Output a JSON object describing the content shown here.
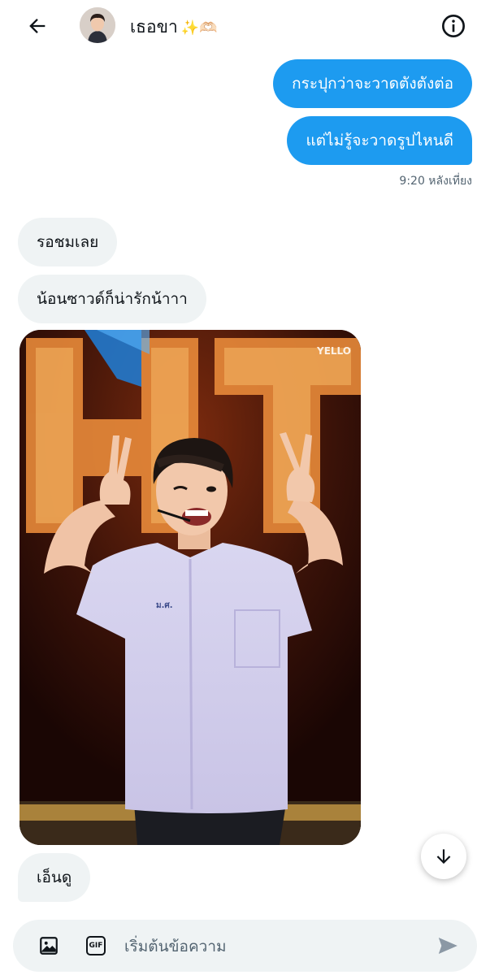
{
  "header": {
    "contact_name": "เธอขา",
    "contact_emojis": "✨🫶🏻"
  },
  "messages": {
    "sent_1": "กระปุกว่าจะวาดตังตังต่อ",
    "sent_2": "แต่ไม่รู้จะวาดรูปไหนดี",
    "sent_time": "9:20 หลังเที่ยง",
    "received_1": "รอชมเลย",
    "received_2": "น้อนซาวด์ก็น่ารักน้าาา",
    "photo_watermark": "YELLO",
    "photo_badge_text": "ม.ศ.",
    "received_3": "เอ็นดู"
  },
  "composer": {
    "placeholder": "เริ่มต้นข้อความ"
  },
  "colors": {
    "accent": "#1d9bf0",
    "bubble_in": "#eff3f4",
    "text": "#0f1419",
    "muted": "#536471"
  },
  "icons": {
    "back": "arrow-left-icon",
    "info": "info-icon",
    "scroll": "arrow-down-icon",
    "image": "image-icon",
    "gif": "gif-icon",
    "send": "send-icon"
  }
}
